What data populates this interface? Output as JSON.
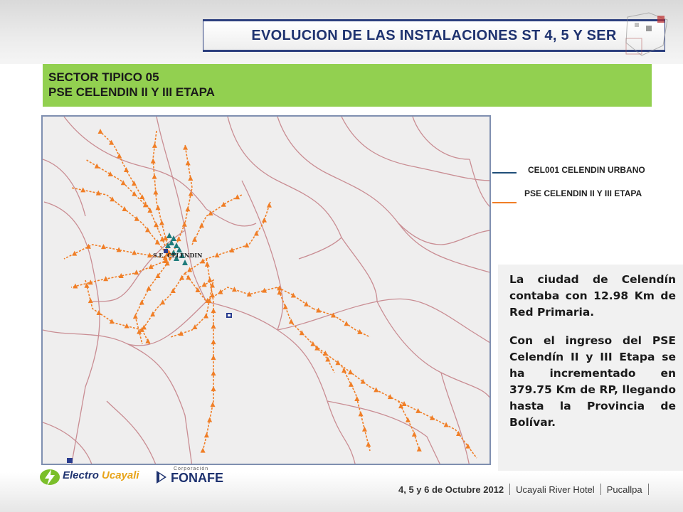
{
  "slide": {
    "title": "EVOLUCION DE LAS INSTALACIONES ST 4, 5 Y SER",
    "sector_line1": "SECTOR TIPICO 05",
    "sector_line2": "PSE CELENDIN II Y III ETAPA"
  },
  "map": {
    "station_label": "S.E. CELENDIN",
    "colors": {
      "roads": "#c98d93",
      "network_orange": "#f07e26",
      "network_teal": "#1e7b7b",
      "background": "#efeeee"
    }
  },
  "legend": [
    {
      "label": "CEL001 CELENDIN URBANO",
      "color": "#1f4e79"
    },
    {
      "label": "PSE CELENDIN II Y III ETAPA",
      "color": "#f07e26"
    }
  ],
  "description": {
    "paragraph1": "La ciudad de Celendín contaba con 12.98 Km de Red Primaria.",
    "paragraph2": "Con el ingreso del PSE Celendín II y III Etapa se ha incrementado en 379.75 Km de RP, llegando hasta la Provincia de Bolívar."
  },
  "footer": {
    "date": "4, 5 y 6 de Octubre 2012",
    "venue": "Ucayali River Hotel",
    "city": "Pucallpa",
    "logo_electro": "Electro",
    "logo_ucayali": "Ucayali",
    "logo_corp": "Corporación",
    "logo_fonafe": "FONAFE"
  }
}
